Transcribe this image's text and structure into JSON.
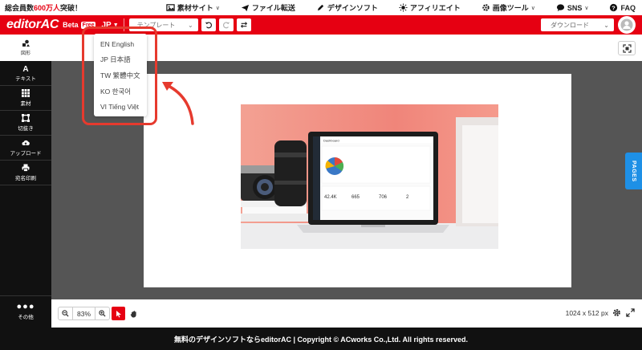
{
  "topbar": {
    "promo_prefix": "総会員数",
    "promo_highlight": "600万人",
    "promo_suffix": "突破！",
    "nav": [
      {
        "label": "素材サイト",
        "icon": "image-icon",
        "has_caret": true
      },
      {
        "label": "ファイル転送",
        "icon": "plane-icon",
        "has_caret": false
      },
      {
        "label": "デザインソフト",
        "icon": "pen-icon",
        "has_caret": false
      },
      {
        "label": "アフィリエイト",
        "icon": "sun-icon",
        "has_caret": false
      },
      {
        "label": "画像ツール",
        "icon": "gear-icon",
        "has_caret": true
      },
      {
        "label": "SNS",
        "icon": "chat-icon",
        "has_caret": true
      },
      {
        "label": "FAQ",
        "icon": "question-icon",
        "has_caret": false
      }
    ]
  },
  "header": {
    "logo": "editorAC",
    "beta": "Beta",
    "free_badge": "Free",
    "language": "JP",
    "template_label": "テンプレート",
    "download_label": "ダウンロード"
  },
  "language_menu": {
    "items": [
      "EN English",
      "JP 日本語",
      "TW 繁體中文",
      "KO 한국어",
      "VI Tiếng Việt"
    ]
  },
  "sidebar": {
    "top_label": "図形",
    "items": [
      {
        "label": "テキスト",
        "icon": "text-icon"
      },
      {
        "label": "素材",
        "icon": "grid-icon"
      },
      {
        "label": "切抜き",
        "icon": "crop-icon"
      },
      {
        "label": "アップロード",
        "icon": "cloud-upload-icon"
      },
      {
        "label": "宛名印刷",
        "icon": "printer-icon"
      }
    ],
    "more_label": "その他"
  },
  "canvas": {
    "pages_tab": "PAGES",
    "photo_dashboard": {
      "title": "Dashboard",
      "stats": [
        "42.4K",
        "665",
        "706",
        "2"
      ]
    }
  },
  "bottombar": {
    "zoom": "83%",
    "dimensions": "1024 x 512 px"
  },
  "footer": {
    "text": "無料のデザインソフトならeditorAC | Copyright © ACworks Co.,Ltd. All rights reserved."
  },
  "colors": {
    "brand_red": "#e60012",
    "pages_blue": "#1e90e6",
    "annotation_red": "#e63a2e"
  }
}
